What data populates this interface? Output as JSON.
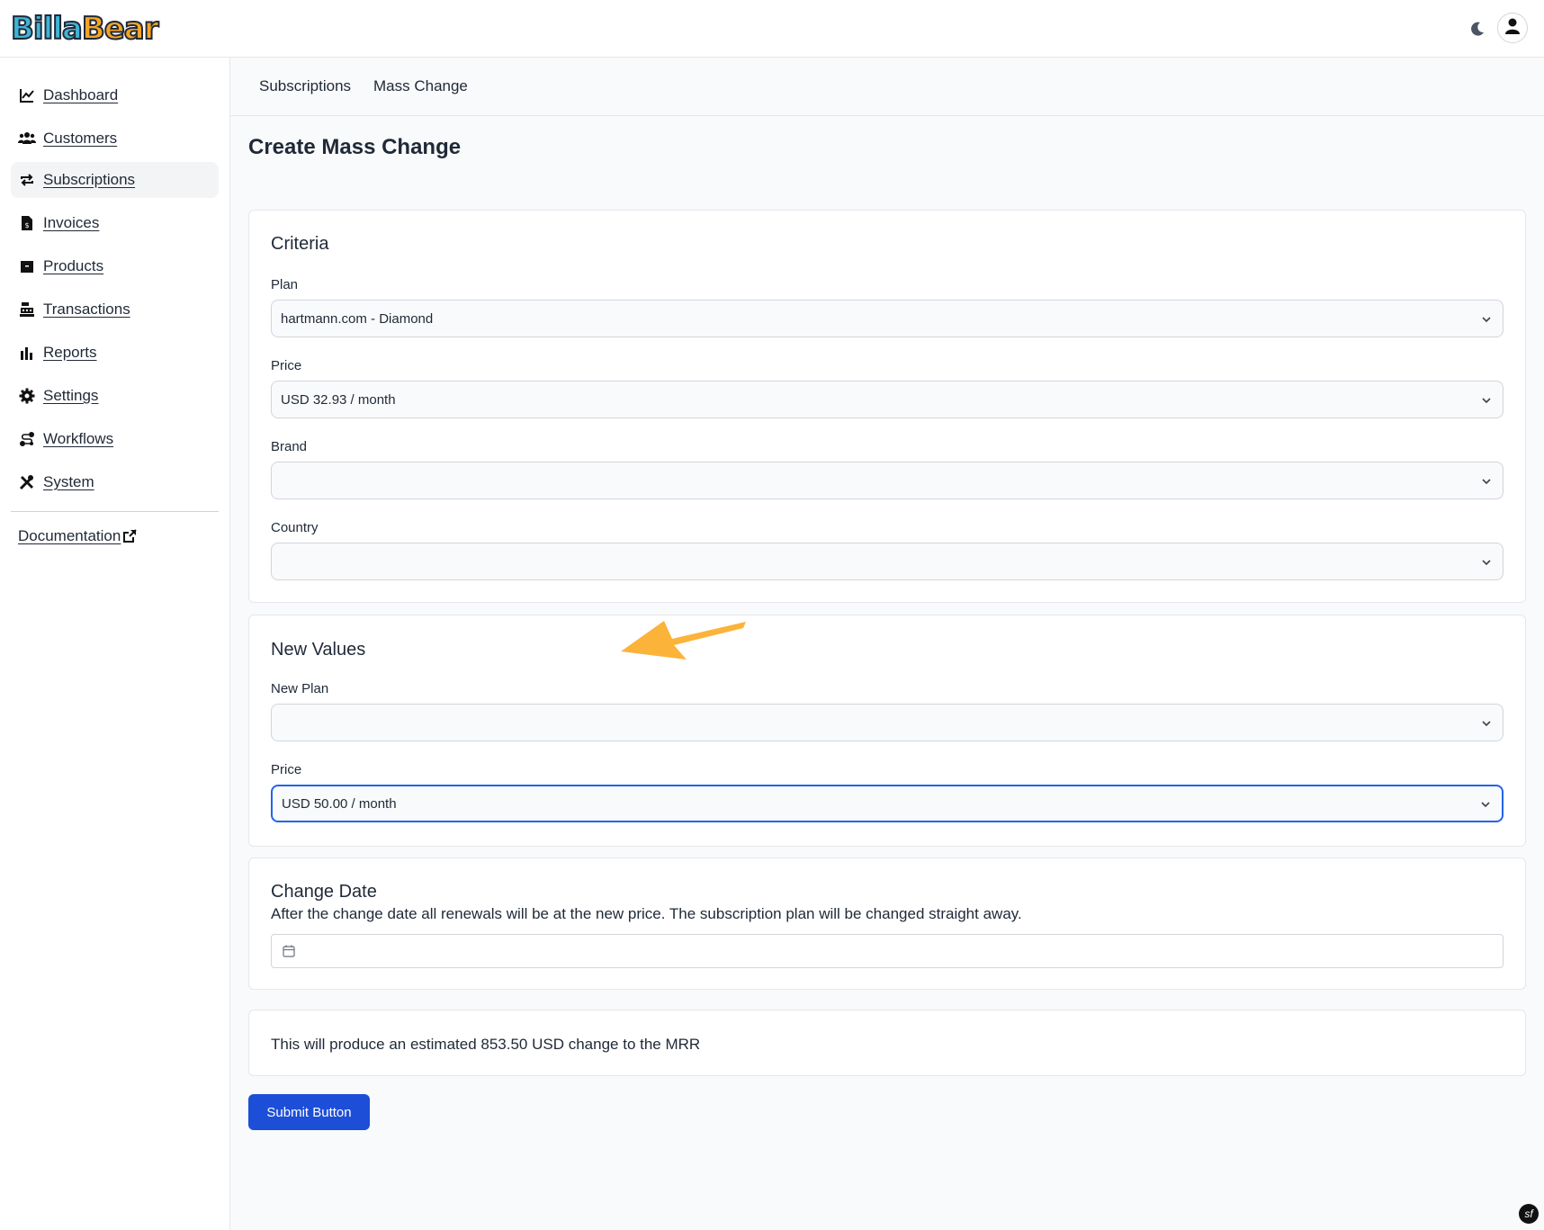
{
  "app": {
    "logo_part1": "Billa",
    "logo_part2": "Bear"
  },
  "sidebar": {
    "items": [
      {
        "label": "Dashboard",
        "icon": "chart-line-icon"
      },
      {
        "label": "Customers",
        "icon": "users-icon"
      },
      {
        "label": "Subscriptions",
        "icon": "repeat-icon",
        "active": true
      },
      {
        "label": "Invoices",
        "icon": "invoice-icon"
      },
      {
        "label": "Products",
        "icon": "box-icon"
      },
      {
        "label": "Transactions",
        "icon": "cash-register-icon"
      },
      {
        "label": "Reports",
        "icon": "bar-chart-icon"
      },
      {
        "label": "Settings",
        "icon": "gear-icon"
      },
      {
        "label": "Workflows",
        "icon": "workflow-icon"
      },
      {
        "label": "System",
        "icon": "tools-icon"
      }
    ],
    "documentation": "Documentation"
  },
  "subnav": {
    "subscriptions": "Subscriptions",
    "mass_change": "Mass Change"
  },
  "page": {
    "title": "Create Mass Change"
  },
  "criteria": {
    "title": "Criteria",
    "plan_label": "Plan",
    "plan_value": "hartmann.com - Diamond",
    "price_label": "Price",
    "price_value": "USD 32.93 / month",
    "brand_label": "Brand",
    "brand_value": "",
    "country_label": "Country",
    "country_value": ""
  },
  "new_values": {
    "title": "New Values",
    "new_plan_label": "New Plan",
    "new_plan_value": "",
    "price_label": "Price",
    "price_value": "USD 50.00 / month"
  },
  "change_date": {
    "title": "Change Date",
    "description": "After the change date all renewals will be at the new price. The subscription plan will be changed straight away.",
    "value": ""
  },
  "estimate": {
    "text": "This will produce an estimated 853.50 USD change to the MRR"
  },
  "actions": {
    "submit_label": "Submit Button"
  },
  "colors": {
    "primary": "#1d4ed8",
    "focus": "#2563eb",
    "arrow": "#fbb339"
  }
}
